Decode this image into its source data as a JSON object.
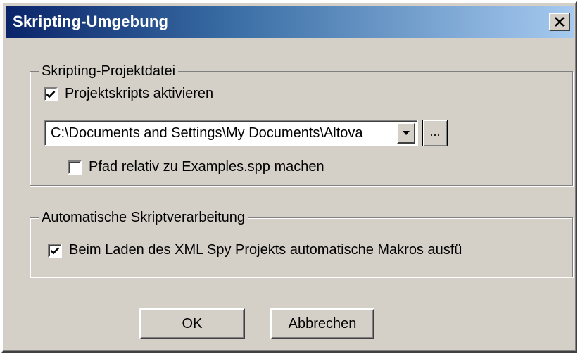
{
  "window": {
    "title": "Skripting-Umgebung",
    "close_label": "X"
  },
  "project_group": {
    "label": "Skripting-Projektdatei",
    "enable_scripts": {
      "label": "Projektskripts aktivieren",
      "checked": true
    },
    "path": {
      "value": "C:\\Documents and Settings\\My Documents\\Altova"
    },
    "browse_label": "...",
    "relative_path": {
      "label": "Pfad relativ zu Examples.spp machen",
      "checked": false
    }
  },
  "auto_group": {
    "label": "Automatische Skriptverarbeitung",
    "auto_macros": {
      "label": "Beim Laden des XML Spy Projekts automatische Makros ausfü",
      "checked": true
    }
  },
  "buttons": {
    "ok": "OK",
    "cancel": "Abbrechen"
  },
  "icons": {
    "close": "close-icon",
    "checkmark": "checkmark-icon",
    "dropdown": "chevron-down-icon"
  }
}
